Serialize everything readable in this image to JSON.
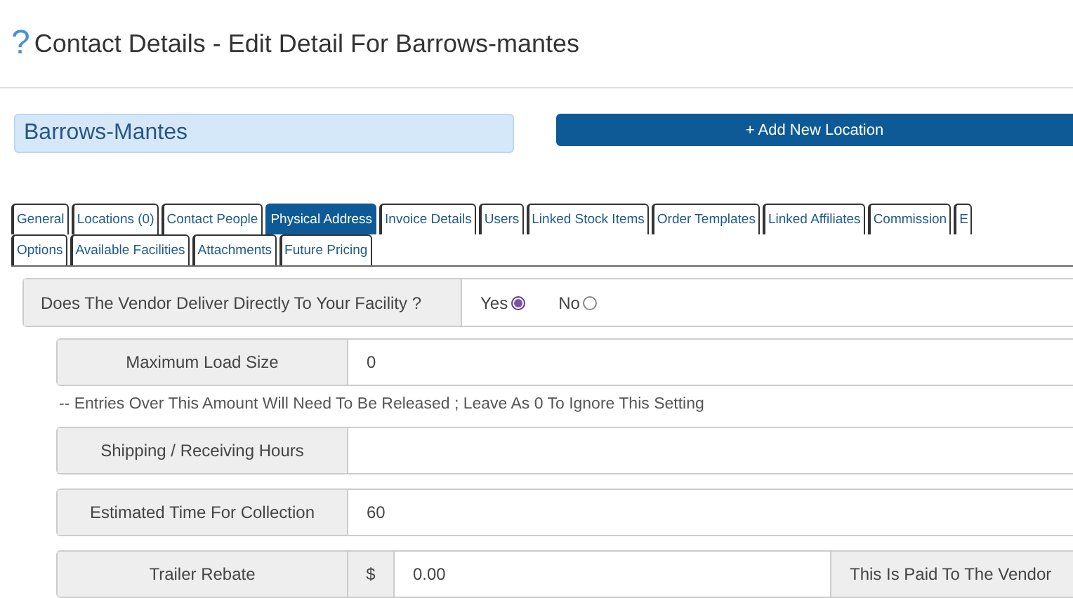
{
  "header": {
    "help_glyph": "?",
    "title": "Contact Details - Edit Detail For Barrows-mantes"
  },
  "name_field": {
    "value": "Barrows-Mantes"
  },
  "add_button": {
    "label": "+ Add New Location"
  },
  "tab_rows": [
    [
      {
        "label": "General",
        "selected": false
      },
      {
        "label": "Locations (0)",
        "selected": false
      },
      {
        "label": "Contact People",
        "selected": false
      },
      {
        "label": "Physical Address",
        "selected": true
      },
      {
        "label": "Invoice Details",
        "selected": false
      },
      {
        "label": "Users",
        "selected": false
      },
      {
        "label": "Linked Stock Items",
        "selected": false
      },
      {
        "label": "Order Templates",
        "selected": false
      },
      {
        "label": "Linked Affiliates",
        "selected": false
      },
      {
        "label": "Commission",
        "selected": false
      },
      {
        "label": "E",
        "selected": false
      }
    ],
    [
      {
        "label": "Options",
        "selected": false
      },
      {
        "label": "Available Facilities",
        "selected": false
      },
      {
        "label": "Attachments",
        "selected": false
      },
      {
        "label": "Future Pricing",
        "selected": false
      }
    ]
  ],
  "question": {
    "label": "Does The Vendor Deliver Directly To Your Facility ?",
    "options": [
      {
        "label": "Yes",
        "selected": true
      },
      {
        "label": "No",
        "selected": false
      }
    ]
  },
  "fields": [
    {
      "kind": "text",
      "label": "Maximum Load Size",
      "value": "0"
    },
    {
      "kind": "note",
      "text": "-- Entries Over This Amount Will Need To Be Released ; Leave As 0 To Ignore This Setting"
    },
    {
      "kind": "text",
      "label": "Shipping / Receiving Hours"
    },
    {
      "kind": "text",
      "label": "Estimated Time For Collection",
      "value": "60"
    },
    {
      "kind": "currency",
      "label": "Trailer Rebate",
      "prefix": "$",
      "value": "0.00",
      "suffix": "This Is Paid To The Vendor"
    }
  ]
}
